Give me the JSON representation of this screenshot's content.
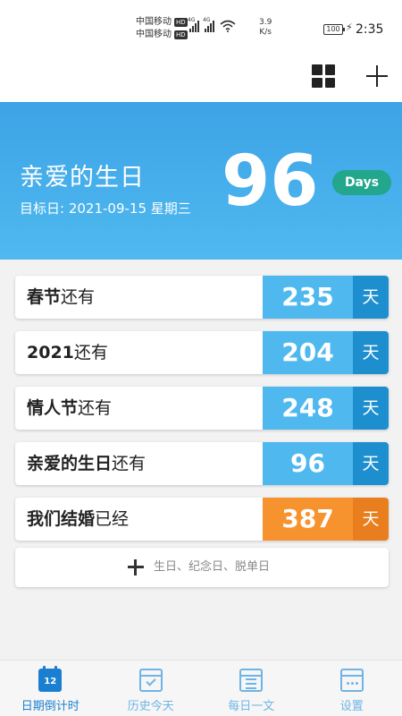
{
  "status": {
    "carrier1": "中国移动",
    "carrier2": "中国移动",
    "hd": "HD",
    "net1": "4G",
    "net2": "4G",
    "speed_value": "3.9",
    "speed_unit": "K/s",
    "battery": "100",
    "time": "2:35"
  },
  "appbar": {
    "grid_icon": "grid-icon",
    "add_icon": "plus-icon"
  },
  "hero": {
    "title": "亲爱的生日",
    "date_label": "目标日: 2021-09-15 星期三",
    "count": "96",
    "unit_pill": "Days",
    "pill_color": "#22a78d"
  },
  "events": [
    {
      "bold": "春节",
      "suffix": "还有",
      "count": "235",
      "unit": "天",
      "status": "future"
    },
    {
      "bold": "2021",
      "suffix": "还有",
      "count": "204",
      "unit": "天",
      "status": "future"
    },
    {
      "bold": "情人节",
      "suffix": "还有",
      "count": "248",
      "unit": "天",
      "status": "future"
    },
    {
      "bold": "亲爱的生日",
      "suffix": "还有",
      "count": "96",
      "unit": "天",
      "status": "future"
    },
    {
      "bold": "我们结婚",
      "suffix": "已经",
      "count": "387",
      "unit": "天",
      "status": "past"
    }
  ],
  "colors": {
    "future": "#4fb9ef",
    "future_unit": "#1e8fce",
    "past": "#f7932f",
    "past_unit": "#e87e1d"
  },
  "add_row": {
    "label": "生日、纪念日、脱单日"
  },
  "nav": {
    "tabs": [
      {
        "label": "日期倒计时",
        "icon": "calendar-icon",
        "badge": "12",
        "active": true
      },
      {
        "label": "历史今天",
        "icon": "calendar-check-icon",
        "active": false
      },
      {
        "label": "每日一文",
        "icon": "notes-icon",
        "active": false
      },
      {
        "label": "设置",
        "icon": "calendar-dots-icon",
        "active": false
      }
    ]
  }
}
